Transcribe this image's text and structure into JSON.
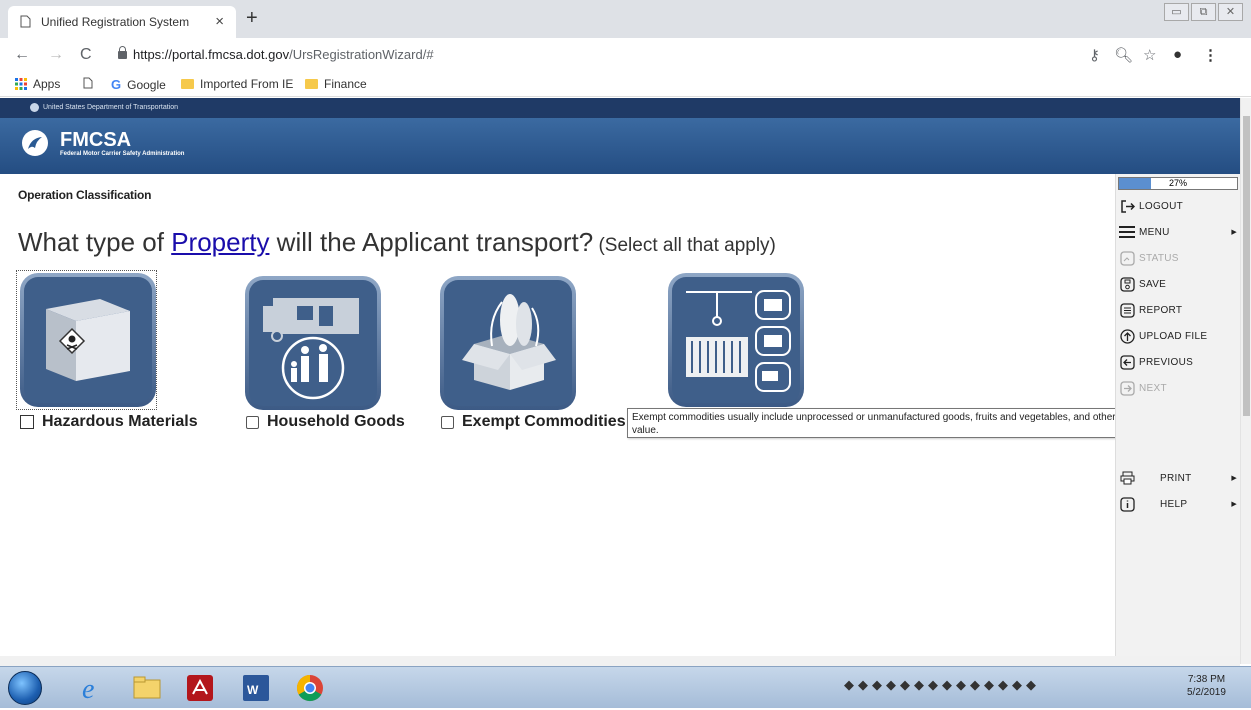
{
  "browser": {
    "tab_title": "Unified Registration System",
    "url_host": "https://portal.fmcsa.dot.gov",
    "url_path": "/UrsRegistrationWizard/#",
    "bookmarks": [
      "Apps",
      "Google",
      "Imported From IE",
      "Finance"
    ]
  },
  "header": {
    "dot_label": "United States Department of Transportation",
    "agency_short": "FMCSA",
    "agency_full": "Federal Motor Carrier Safety Administration"
  },
  "page": {
    "section": "Operation Classification",
    "question_prefix": "What type of ",
    "question_link": "Property",
    "question_suffix": " will the Applicant transport?",
    "question_hint": " (Select all that apply)"
  },
  "options": [
    {
      "label": "Hazardous Materials"
    },
    {
      "label": "Household Goods"
    },
    {
      "label": "Exempt Commodities"
    }
  ],
  "tooltip": "Exempt commodities usually include unprocessed or unmanufactured goods, fruits and vegetables, and other items of little or no value.",
  "sidepanel": {
    "progress_label": "27%",
    "progress_value": 0.27,
    "items": [
      {
        "label": "LOGOUT"
      },
      {
        "label": "MENU"
      },
      {
        "label": "STATUS"
      },
      {
        "label": "SAVE"
      },
      {
        "label": "REPORT"
      },
      {
        "label": "UPLOAD FILE"
      },
      {
        "label": "PREVIOUS"
      },
      {
        "label": "NEXT"
      },
      {
        "label": "PRINT"
      },
      {
        "label": "HELP"
      }
    ]
  },
  "taskbar": {
    "time": "7:38 PM",
    "date": "5/2/2019"
  }
}
